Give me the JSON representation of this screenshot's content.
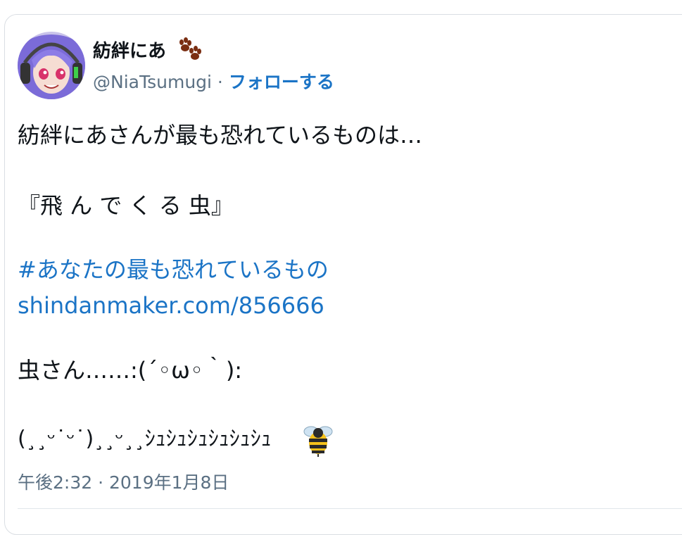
{
  "tweet": {
    "display_name": "紡絆にあ",
    "handle": "@NiaTsumugi",
    "separator": " · ",
    "follow_label": "フォローする",
    "lines": {
      "line1": "紡絆にあさんが最も恐れているものは…",
      "line2": "『飛 ん で く る 虫』",
      "hashtag": "#あなたの最も恐れているもの",
      "url": "shindanmaker.com/856666",
      "line3": "虫さん……:(´◦ω◦｀):",
      "line4": "(¸¸ᵕ˙ᵕ˙)¸¸ᵕ¸¸ｼｭｼｭｼｭｼｭｼｭｼｭ"
    },
    "timestamp": "午後2:32 · 2019年1月8日"
  },
  "colors": {
    "link": "#1b74c6",
    "text": "#0f1419",
    "secondary": "#5b7083",
    "avatar_hair": "#7b6bd8"
  },
  "icons": {
    "paw": "paw-prints-icon",
    "bee": "bee-icon",
    "avatar": "avatar"
  }
}
